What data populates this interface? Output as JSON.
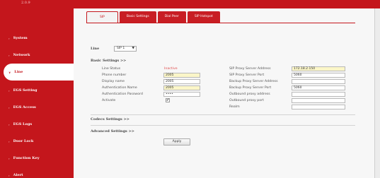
{
  "brand": "2.0.9",
  "sidebar": {
    "items": [
      {
        "label": "System",
        "active": false
      },
      {
        "label": "Network",
        "active": false
      },
      {
        "label": "Line",
        "active": true
      },
      {
        "label": "EGS Setting",
        "active": false
      },
      {
        "label": "EGS Access",
        "active": false
      },
      {
        "label": "EGS Logs",
        "active": false
      },
      {
        "label": "Door Lock",
        "active": false
      },
      {
        "label": "Function Key",
        "active": false
      },
      {
        "label": "Alert",
        "active": false
      }
    ]
  },
  "tabs": [
    {
      "label": "SIP",
      "active": true
    },
    {
      "label": "Basic Settings",
      "active": false
    },
    {
      "label": "Dial Peer",
      "active": false
    },
    {
      "label": "SIP Hotspot",
      "active": false
    }
  ],
  "line": {
    "label": "Line",
    "value": "SIP 1",
    "caret": "▼"
  },
  "basic": {
    "heading": "Basic Settings >>",
    "left": [
      {
        "label": "Line Status",
        "value": "Inactive"
      },
      {
        "label": "Phone number",
        "value": "2005"
      },
      {
        "label": "Display name",
        "value": "2005"
      },
      {
        "label": "Authentication Name",
        "value": "2005"
      },
      {
        "label": "Authentication Password",
        "value": "••••"
      },
      {
        "label": "Activate",
        "value": "✔"
      }
    ],
    "right": [
      {
        "label": "SIP Proxy Server Address",
        "value": "172.18.2.150"
      },
      {
        "label": "SIP Proxy Server Port",
        "value": "5060"
      },
      {
        "label": "Backup Proxy Server Address",
        "value": ""
      },
      {
        "label": "Backup Proxy Server Port",
        "value": "5060"
      },
      {
        "label": "Outbound proxy address",
        "value": ""
      },
      {
        "label": "Outbound proxy port",
        "value": ""
      },
      {
        "label": "Realm",
        "value": ""
      }
    ]
  },
  "codecs": {
    "heading": "Codecs Settings >>"
  },
  "advanced": {
    "heading": "Advanced Settings >>"
  },
  "apply": "Apply",
  "colors": {
    "brand_red": "#c4161c",
    "highlight_yellow": "#fbf6c8",
    "status_red": "#e04a4a"
  }
}
